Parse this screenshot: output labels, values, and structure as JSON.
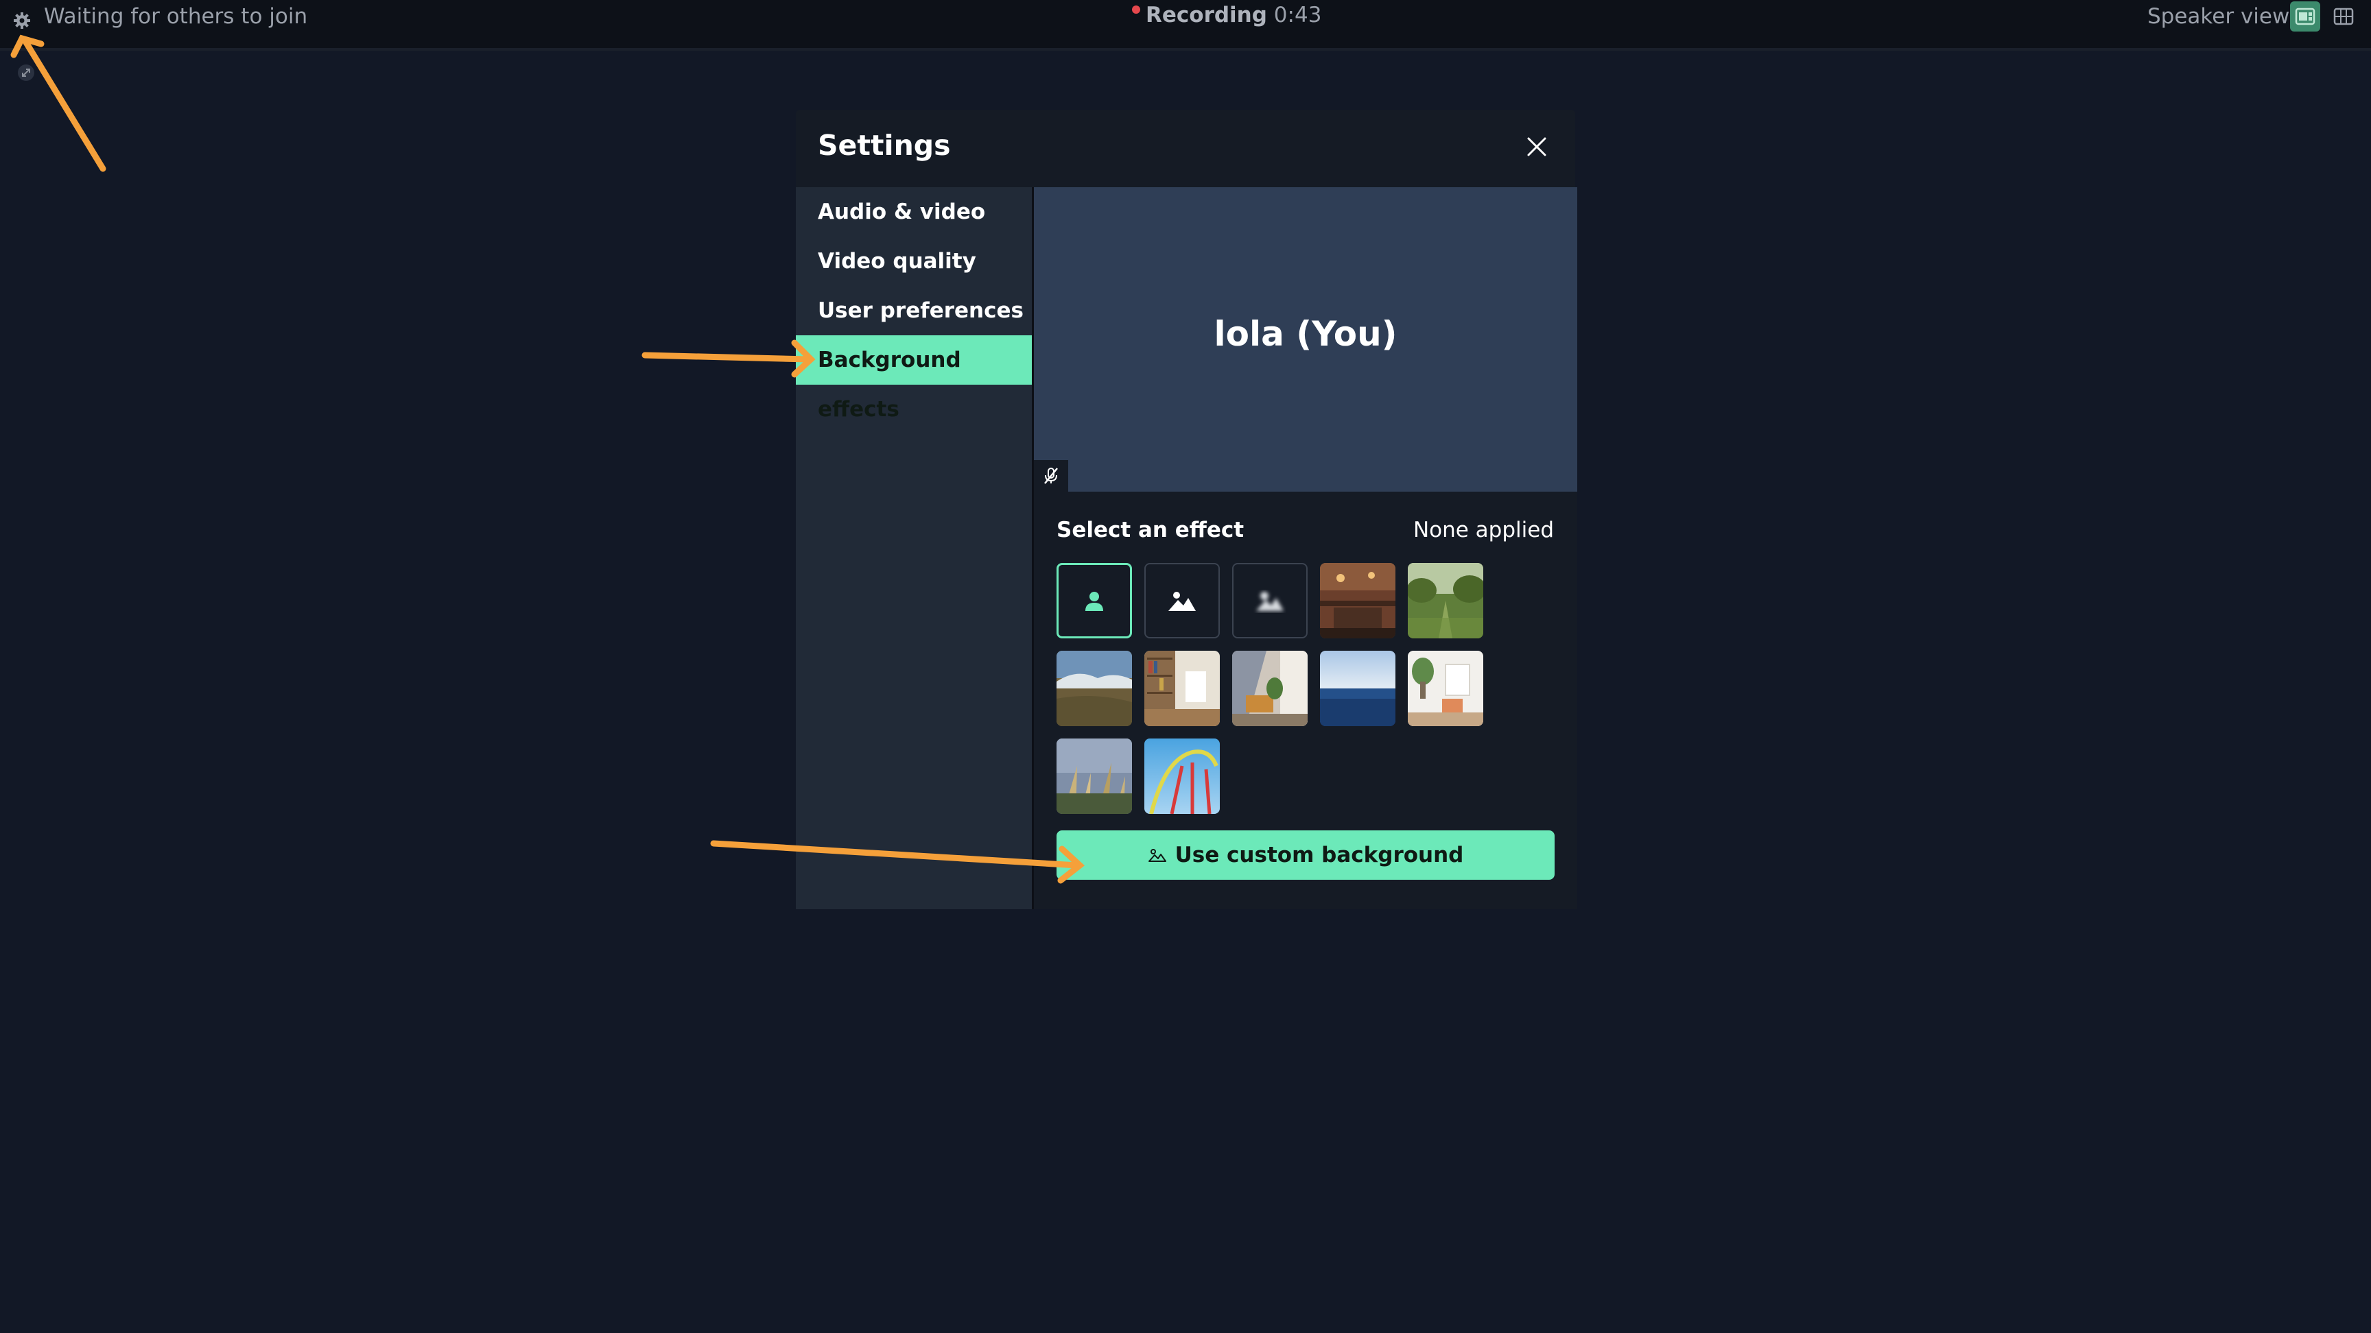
{
  "topbar": {
    "status_text": "Waiting for others to join",
    "recording_label": "Recording",
    "recording_time": "0:43",
    "view_label": "Speaker view"
  },
  "settings": {
    "title": "Settings",
    "nav": [
      {
        "label": "Audio & video"
      },
      {
        "label": "Video quality"
      },
      {
        "label": "User preferences"
      },
      {
        "label": "Background effects",
        "active": true
      }
    ],
    "preview_name": "lola (You)",
    "effects": {
      "section_label": "Select an effect",
      "applied_text": "None applied",
      "options": [
        "none",
        "background-blur",
        "strong-blur"
      ],
      "selected": "none",
      "background_images": [
        "brick-cafe",
        "green-orchard",
        "coastal-hills",
        "bookshelf-room",
        "sunny-living-room",
        "ocean-horizon",
        "bright-apartment",
        "tall-grass",
        "roller-coaster"
      ]
    },
    "custom_button_label": "Use custom background"
  },
  "icons": {
    "gear": "gear-icon",
    "close": "close-icon",
    "mic_off": "mic-off-icon",
    "person": "person-icon",
    "mountain": "mountain-icon",
    "speaker_view": "speaker-view-icon",
    "grid_view": "grid-view-icon"
  },
  "colors": {
    "accent": "#6ce9b9",
    "background": "#121826",
    "sidebar": "#212a37",
    "preview": "#2f3e56",
    "recording_dot": "#e5484d",
    "annotation_arrow": "#f5a03a"
  }
}
